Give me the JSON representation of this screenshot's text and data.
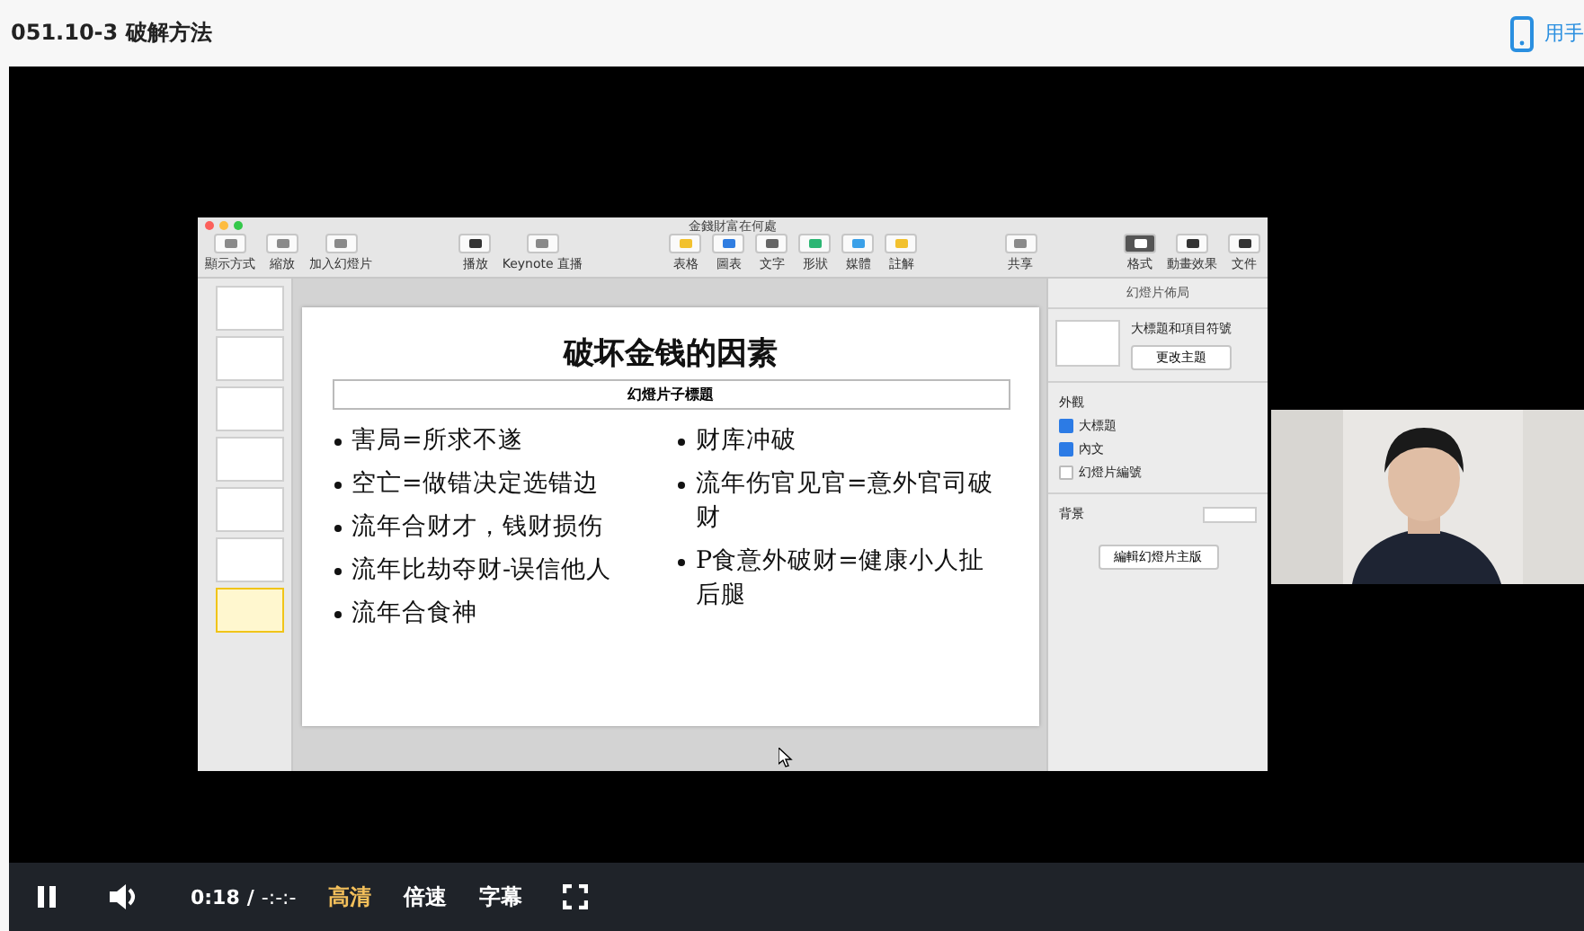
{
  "header": {
    "title": "051.10-3 破解方法",
    "link_text": "用手"
  },
  "keynote": {
    "window_title": "金錢財富在何處",
    "toolbar": [
      [
        {
          "label": "顯示方式",
          "color": "#8a8a8a",
          "selected": false
        },
        {
          "label": "縮放",
          "color": "#8a8a8a",
          "selected": false
        },
        {
          "label": "加入幻燈片",
          "color": "#8a8a8a",
          "selected": false
        }
      ],
      [
        {
          "label": "播放",
          "color": "#333333",
          "selected": false
        },
        {
          "label": "Keynote 直播",
          "color": "#8a8a8a",
          "selected": false
        }
      ],
      [
        {
          "label": "表格",
          "color": "#f2c12e",
          "selected": false
        },
        {
          "label": "圖表",
          "color": "#2f7de1",
          "selected": false
        },
        {
          "label": "文字",
          "color": "#666666",
          "selected": false
        },
        {
          "label": "形狀",
          "color": "#2bb673",
          "selected": false
        },
        {
          "label": "媒體",
          "color": "#3aa0e8",
          "selected": false
        },
        {
          "label": "註解",
          "color": "#f2c12e",
          "selected": false
        }
      ],
      [
        {
          "label": "共享",
          "color": "#8a8a8a",
          "selected": false
        }
      ],
      [
        {
          "label": "格式",
          "color": "#ffffff",
          "selected": true
        },
        {
          "label": "動畫效果",
          "color": "#333333",
          "selected": false
        },
        {
          "label": "文件",
          "color": "#333333",
          "selected": false
        }
      ]
    ],
    "thumbnails": [
      {
        "selected": false
      },
      {
        "selected": false
      },
      {
        "selected": false
      },
      {
        "selected": false
      },
      {
        "selected": false
      },
      {
        "selected": false
      },
      {
        "selected": true
      }
    ],
    "slide": {
      "title": "破坏金钱的因素",
      "subtitle": "幻燈片子標題",
      "columns": [
        [
          "害局=所求不遂",
          "空亡=做错决定选错边",
          "流年合财才，钱财损伤",
          "流年比劫夺财-误信他人",
          "流年合食神"
        ],
        [
          "财库冲破",
          "流年伤官见官=意外官司破财",
          "P食意外破财=健康小人扯后腿"
        ]
      ]
    },
    "sidebar": {
      "heading": "幻燈片佈局",
      "layout_name": "大標題和項目符號",
      "change_theme": "更改主題",
      "appearance_label": "外觀",
      "options": [
        {
          "label": "大標題",
          "checked": true
        },
        {
          "label": "內文",
          "checked": true
        },
        {
          "label": "幻燈片編號",
          "checked": false
        }
      ],
      "background_label": "背景",
      "edit_master": "編輯幻燈片主版"
    }
  },
  "controls": {
    "time": "0:18",
    "separator": "/",
    "duration": "-:-:-",
    "playing": true,
    "buttons": [
      {
        "label": "高清",
        "selected": true
      },
      {
        "label": "倍速",
        "selected": false
      },
      {
        "label": "字幕",
        "selected": false
      }
    ]
  }
}
